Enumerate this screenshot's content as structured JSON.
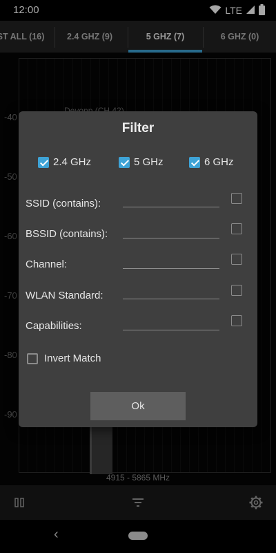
{
  "status_bar": {
    "time": "12:00",
    "network": "LTE"
  },
  "tabs": [
    {
      "label": "ST ALL (16)"
    },
    {
      "label": "2.4 GHZ (9)"
    },
    {
      "label": "5 GHZ (7)",
      "active": true
    },
    {
      "label": "6 GHZ (0)"
    }
  ],
  "chart": {
    "y_ticks": [
      "-40",
      "-50",
      "-60",
      "-70",
      "-80",
      "-90"
    ],
    "network_label": "Devonp (CH 42)",
    "x_range": "4915 - 5865 MHz"
  },
  "dialog": {
    "title": "Filter",
    "bands": [
      {
        "label": "2.4 GHz",
        "checked": true
      },
      {
        "label": "5 GHz",
        "checked": true
      },
      {
        "label": "6 GHz",
        "checked": true
      }
    ],
    "fields": [
      {
        "label": "SSID (contains):",
        "value": ""
      },
      {
        "label": "BSSID (contains):",
        "value": ""
      },
      {
        "label": "Channel:",
        "value": ""
      },
      {
        "label": "WLAN Standard:",
        "value": ""
      },
      {
        "label": "Capabilities:",
        "value": ""
      }
    ],
    "invert_label": "Invert Match",
    "ok_label": "Ok"
  },
  "colors": {
    "accent": "#3ea3d6",
    "dialog_bg": "#3f3f3f",
    "button_bg": "#5e5e5e"
  },
  "icons": {
    "pause": "pause-icon",
    "filter": "filter-icon",
    "settings": "gear-icon",
    "back": "back-icon"
  }
}
